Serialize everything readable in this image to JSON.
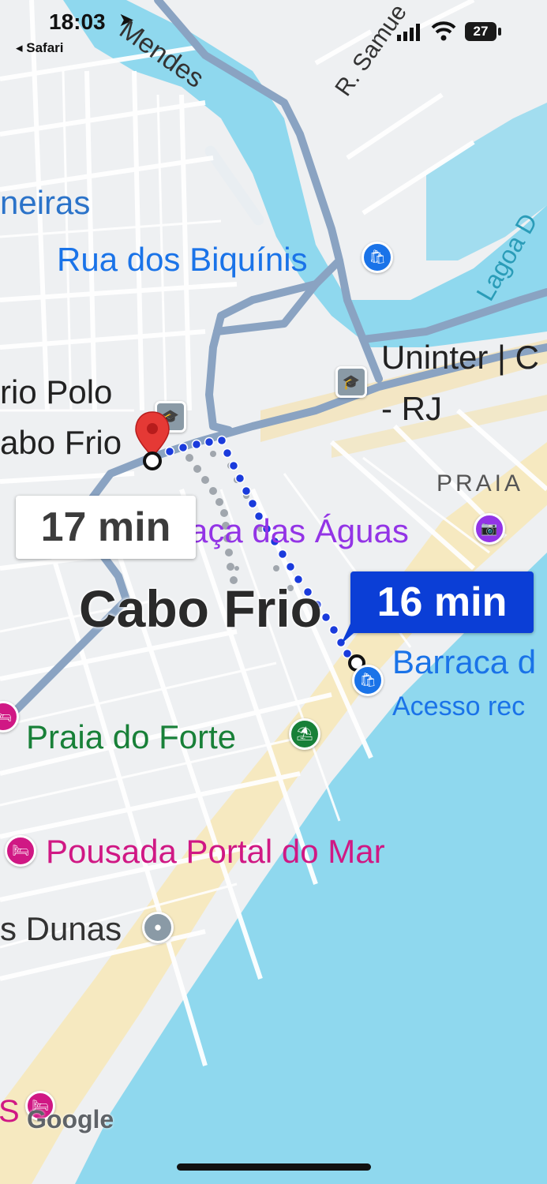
{
  "status_bar": {
    "time": "18:03",
    "back_app": "◂ Safari",
    "battery": "27"
  },
  "map": {
    "city_label": "Cabo Frio",
    "labels": {
      "street_mendes": "Mendes",
      "street_samuel": "R. Samue",
      "neighborhood_palmeiras": "neiras",
      "rua_dos_biquinis": "Rua dos Biquínis",
      "lagoa": "Lagoa D",
      "uninter_line1": "Uninter | C",
      "uninter_line2": "- RJ",
      "polo_line1": "rio Polo",
      "polo_line2": "abo Frio",
      "praia_area": "PRAIA",
      "praca_das_aguas": "aça das Águas",
      "barraca": "Barraca d",
      "acesso": "Acesso rec",
      "praia_do_forte": "Praia do Forte",
      "pousada": "Pousada Portal do Mar",
      "dunas": "s Dunas",
      "bottom_s": "S"
    },
    "route_badges": {
      "alternate": "17 min",
      "selected": "16 min"
    },
    "attribution": "Google",
    "colors": {
      "water": "#8fd8ee",
      "beach": "#f6e9c0",
      "road": "#ffffff",
      "main_road": "#8aa3c2",
      "route_blue": "#1a3bdc",
      "route_gray": "#a0a6ad",
      "poi_blue": "#1a73e8",
      "poi_green": "#188038",
      "poi_purple": "#9334e6",
      "poi_pink": "#d01884",
      "marker_red": "#e53935"
    }
  }
}
